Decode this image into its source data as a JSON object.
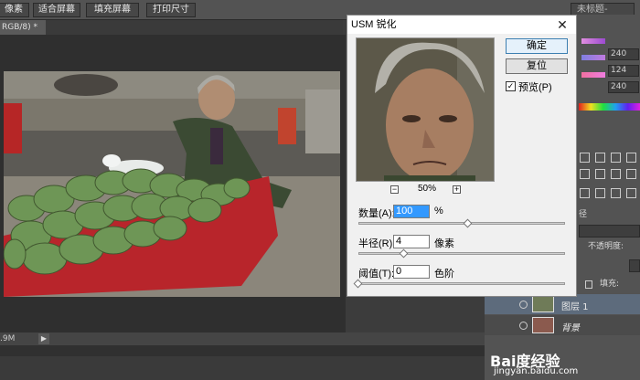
{
  "options_bar": {
    "btn1": "像素",
    "btn2": "适合屏幕",
    "btn3": "填充屏幕",
    "btn4": "打印尺寸",
    "workspace": "未标题-"
  },
  "doc_tab": {
    "label": "RGB/8) *  ×"
  },
  "status": {
    "size": ".9M",
    "arrow": "▶"
  },
  "dialog": {
    "title": "USM 锐化",
    "close": "✕",
    "ok": "确定",
    "reset": "复位",
    "preview_label": "预览(P)",
    "preview_checked": "✓",
    "zoom_out": "−",
    "zoom_in": "+",
    "zoom": "50%",
    "amount_label": "数量(A):",
    "amount_value": "100",
    "amount_unit": "%",
    "amount_level": 0.53,
    "radius_label": "半径(R):",
    "radius_value": "4",
    "radius_unit": "像素",
    "radius_level": 0.22,
    "threshold_label": "阈值(T):",
    "threshold_value": "0",
    "threshold_unit": "色阶",
    "threshold_level": 0.0
  },
  "color_panel": {
    "values": [
      "240",
      "124",
      "240"
    ]
  },
  "layers_panel": {
    "tab": "径",
    "opacity_label": "不透明度:",
    "fill_label": "填充:",
    "layers": [
      {
        "name": "图层 1"
      },
      {
        "name": "背景"
      }
    ]
  },
  "watermark": {
    "brand": "Bai度经验",
    "url": "jingyan.baidu.com"
  }
}
